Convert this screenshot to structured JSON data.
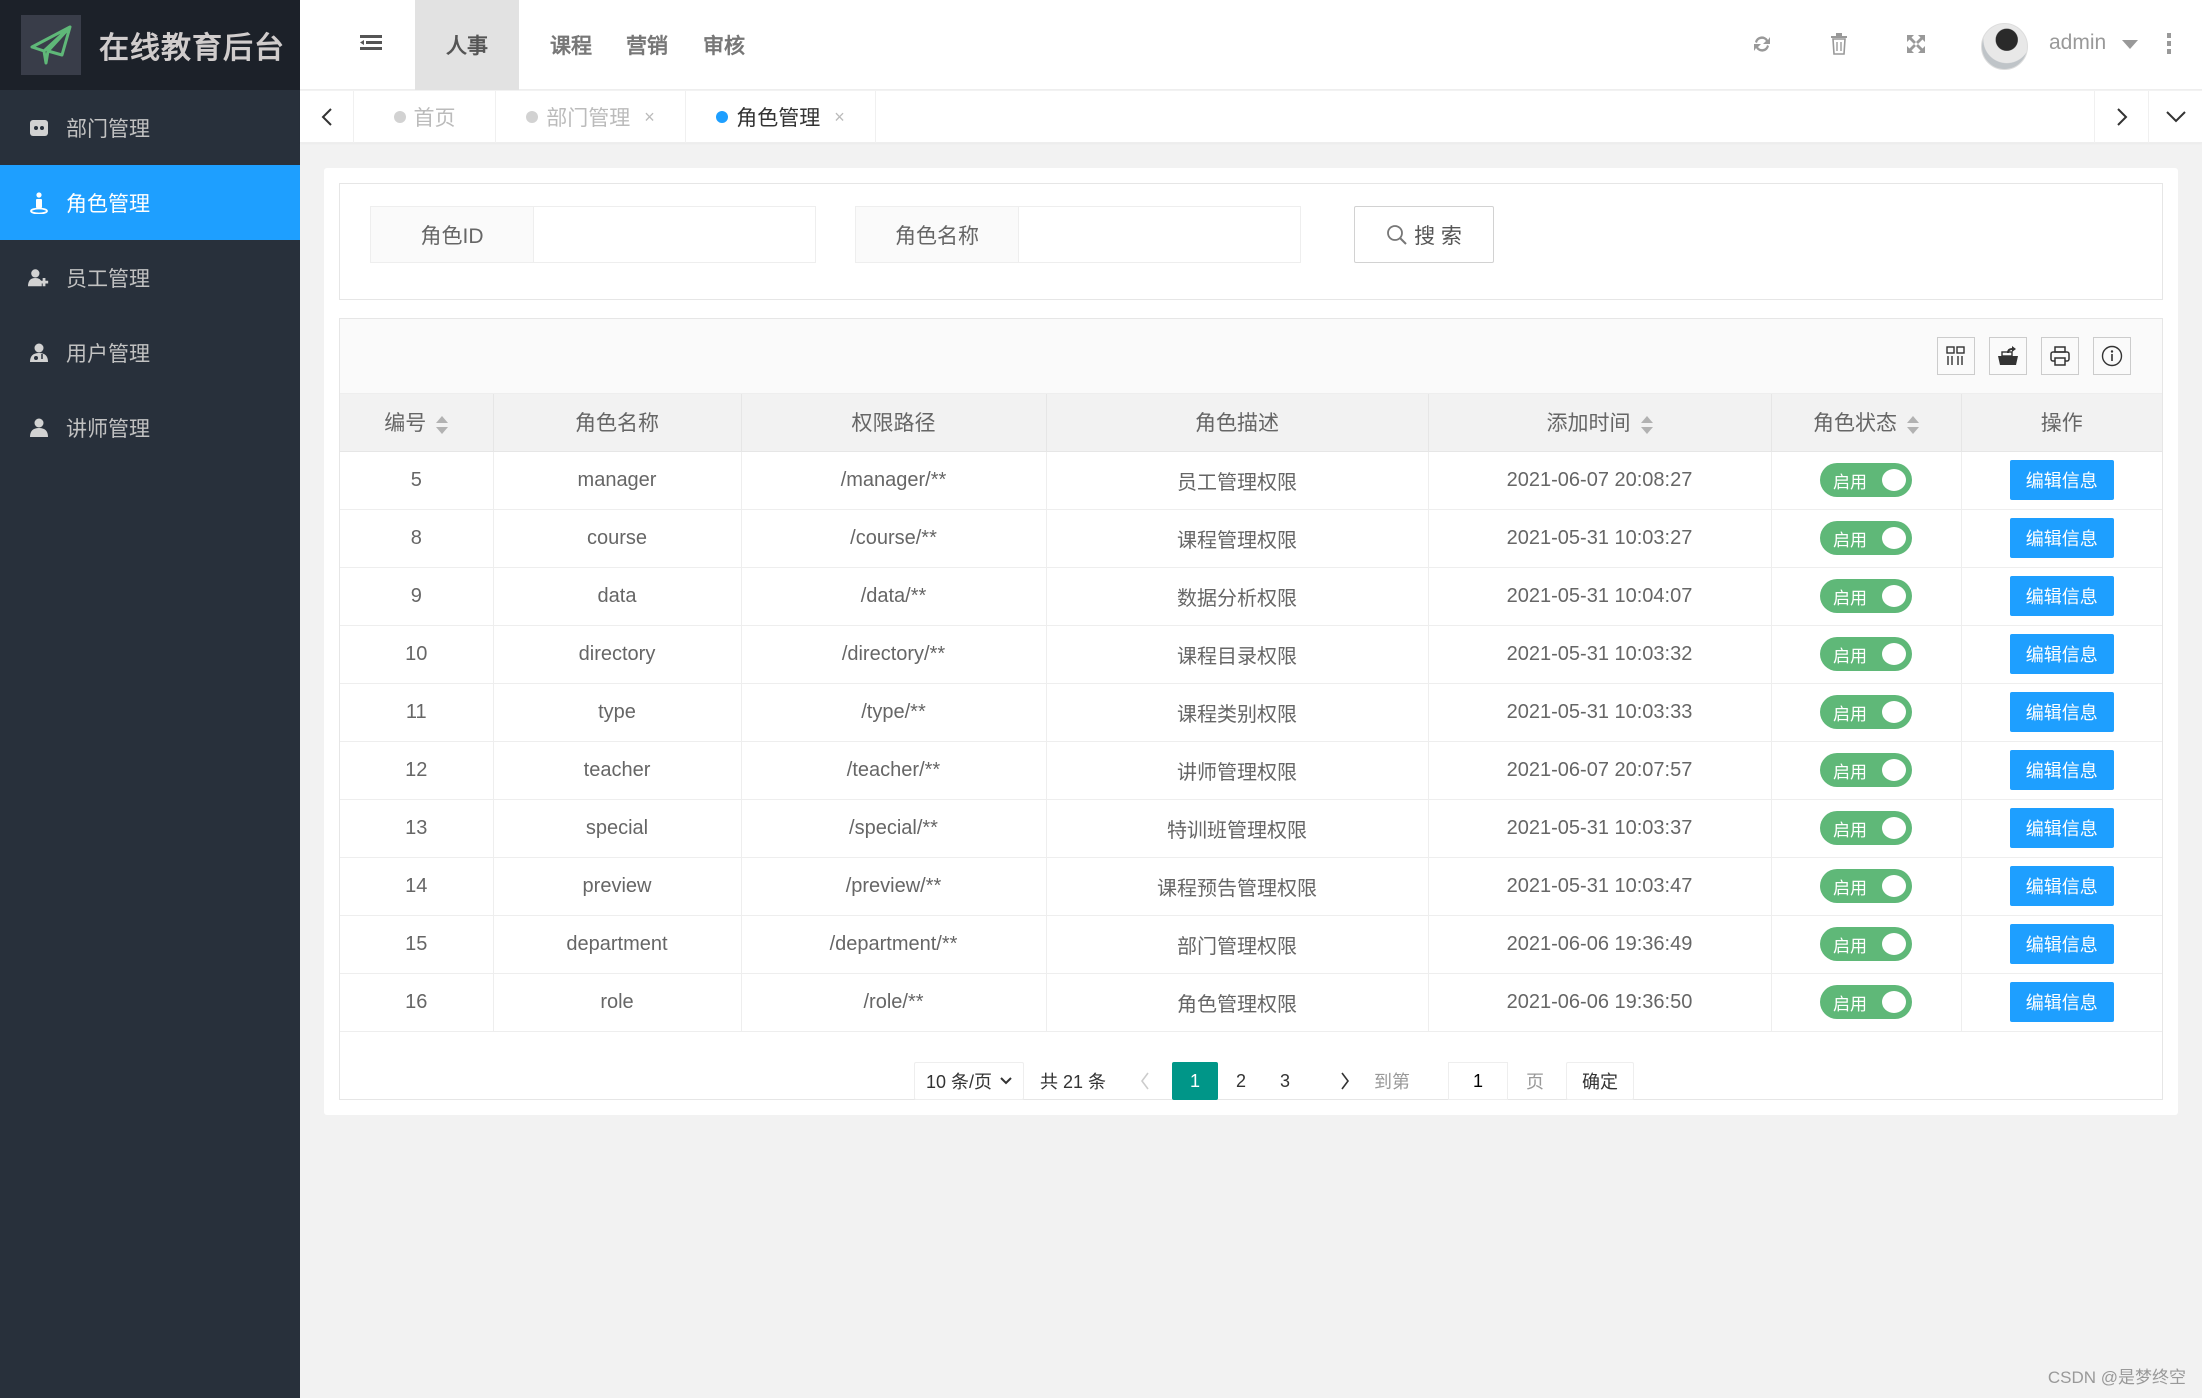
{
  "app": {
    "title": "在线教育后台"
  },
  "sidebar": {
    "items": [
      {
        "label": "部门管理",
        "icon": "department-icon",
        "active": false
      },
      {
        "label": "角色管理",
        "icon": "role-icon",
        "active": true
      },
      {
        "label": "员工管理",
        "icon": "user-add-icon",
        "active": false
      },
      {
        "label": "用户管理",
        "icon": "user-doctor-icon",
        "active": false
      },
      {
        "label": "讲师管理",
        "icon": "user-icon",
        "active": false
      }
    ]
  },
  "header": {
    "nav": [
      {
        "label": "人事",
        "active": true
      },
      {
        "label": "课程",
        "active": false
      },
      {
        "label": "营销",
        "active": false
      },
      {
        "label": "审核",
        "active": false
      }
    ],
    "icons": [
      "refresh-icon",
      "trash-icon",
      "fullscreen-icon"
    ],
    "user": {
      "name": "admin"
    }
  },
  "tabs": [
    {
      "label": "首页",
      "closable": false,
      "active": false
    },
    {
      "label": "部门管理",
      "closable": true,
      "active": false
    },
    {
      "label": "角色管理",
      "closable": true,
      "active": true
    }
  ],
  "tab_close_glyph": "×",
  "search": {
    "role_id_label": "角色ID",
    "role_id_value": "",
    "role_name_label": "角色名称",
    "role_name_value": "",
    "button_label": "搜 索"
  },
  "table": {
    "toolbar_icons": [
      "columns-icon",
      "export-icon",
      "print-icon",
      "info-icon"
    ],
    "columns": [
      {
        "label": "编号",
        "sortable": true
      },
      {
        "label": "角色名称",
        "sortable": false
      },
      {
        "label": "权限路径",
        "sortable": false
      },
      {
        "label": "角色描述",
        "sortable": false
      },
      {
        "label": "添加时间",
        "sortable": true
      },
      {
        "label": "角色状态",
        "sortable": true
      },
      {
        "label": "操作",
        "sortable": false
      }
    ],
    "status_label": "启用",
    "action_label": "编辑信息",
    "rows": [
      {
        "id": "5",
        "name": "manager",
        "path": "/manager/**",
        "desc": "员工管理权限",
        "time": "2021-06-07 20:08:27",
        "enabled": true
      },
      {
        "id": "8",
        "name": "course",
        "path": "/course/**",
        "desc": "课程管理权限",
        "time": "2021-05-31 10:03:27",
        "enabled": true
      },
      {
        "id": "9",
        "name": "data",
        "path": "/data/**",
        "desc": "数据分析权限",
        "time": "2021-05-31 10:04:07",
        "enabled": true
      },
      {
        "id": "10",
        "name": "directory",
        "path": "/directory/**",
        "desc": "课程目录权限",
        "time": "2021-05-31 10:03:32",
        "enabled": true
      },
      {
        "id": "11",
        "name": "type",
        "path": "/type/**",
        "desc": "课程类别权限",
        "time": "2021-05-31 10:03:33",
        "enabled": true
      },
      {
        "id": "12",
        "name": "teacher",
        "path": "/teacher/**",
        "desc": "讲师管理权限",
        "time": "2021-06-07 20:07:57",
        "enabled": true
      },
      {
        "id": "13",
        "name": "special",
        "path": "/special/**",
        "desc": "特训班管理权限",
        "time": "2021-05-31 10:03:37",
        "enabled": true
      },
      {
        "id": "14",
        "name": "preview",
        "path": "/preview/**",
        "desc": "课程预告管理权限",
        "time": "2021-05-31 10:03:47",
        "enabled": true
      },
      {
        "id": "15",
        "name": "department",
        "path": "/department/**",
        "desc": "部门管理权限",
        "time": "2021-06-06 19:36:49",
        "enabled": true
      },
      {
        "id": "16",
        "name": "role",
        "path": "/role/**",
        "desc": "角色管理权限",
        "time": "2021-06-06 19:36:50",
        "enabled": true
      }
    ]
  },
  "pagination": {
    "page_size": "10 条/页",
    "total": "共 21 条",
    "pages": [
      "1",
      "2",
      "3"
    ],
    "current": "1",
    "goto_label": "到第",
    "goto_value": "1",
    "page_unit": "页",
    "confirm": "确定"
  },
  "colors": {
    "sidebar_bg": "#28303b",
    "logo_bg": "#1c2129",
    "active_blue": "#1e9fff",
    "switch_green": "#5fb878",
    "pager_current": "#009688"
  },
  "watermark": "CSDN @是梦终空"
}
